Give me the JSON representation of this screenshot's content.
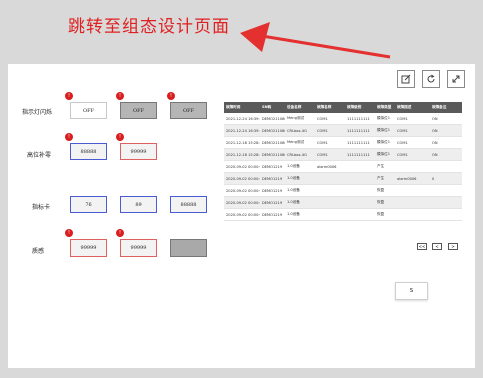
{
  "annotation": {
    "text": "跳转至组态设计页面",
    "color": "#e02020"
  },
  "toolbar": {
    "edit_icon": "edit-icon",
    "refresh_icon": "refresh-icon",
    "expand_icon": "expand-icon"
  },
  "rows": {
    "indicator": {
      "label": "指示灯闪烁",
      "boxes": [
        "OFF",
        "OFF",
        "OFF"
      ],
      "badges": [
        "!",
        "!",
        "!"
      ]
    },
    "high_zero": {
      "label": "高位补零",
      "boxes": [
        "88888",
        "99999"
      ],
      "badges": [
        "!",
        "!"
      ]
    },
    "indicator_card": {
      "label": "指标卡",
      "boxes": [
        "76",
        "89",
        "88888"
      ]
    },
    "gradient": {
      "label": "质感",
      "boxes": [
        "99999",
        "99999",
        ""
      ],
      "badges": [
        "!",
        "!"
      ]
    }
  },
  "table": {
    "headers": [
      "故障时间",
      "SN码",
      "设备名称",
      "故障名称",
      "故障级别",
      "故障类型",
      "故障描述",
      "故障备注"
    ],
    "rows": [
      [
        "2021-12-24 16:39:55",
        "DEMO211086",
        "Meng测试",
        "COM1",
        "1111111111",
        "模拟位1",
        "COM1",
        "ON"
      ],
      [
        "2021-12-24 16:39:55",
        "DEMO211086",
        "CRLbox-4G",
        "COM1",
        "1111111111",
        "模拟位1",
        "COM1",
        "ON"
      ],
      [
        "2021-12-18 15:28:54",
        "DEMO211086",
        "Meng测试",
        "COM1",
        "1111111111",
        "模拟位1",
        "COM1",
        "ON"
      ],
      [
        "2021-12-18 15:28:54",
        "DEMO211086",
        "CRLbox-4G",
        "COM1",
        "1111111111",
        "模拟位1",
        "COM1",
        "ON"
      ],
      [
        "2020-09-02 00:00:00",
        "DEMO1219",
        "1.0设备",
        "alarm0006",
        "",
        "产生",
        "",
        ""
      ],
      [
        "2020-09-02 00:00:00",
        "DEMO1219",
        "1.0设备",
        "",
        "",
        "产生",
        "alarm0006",
        "0"
      ],
      [
        "2020-09-02 00:00:00",
        "DEMO1219",
        "1.0设备",
        "",
        "",
        "恢复",
        "",
        ""
      ],
      [
        "2020-09-02 00:00:00",
        "DEMO1219",
        "1.0设备",
        "",
        "",
        "恢复",
        "",
        ""
      ],
      [
        "2020-09-02 00:00:00",
        "DEMO1219",
        "1.0设备",
        "",
        "",
        "恢复",
        "",
        ""
      ]
    ]
  },
  "pagination": {
    "first": "<<",
    "prev": "<",
    "next": ">"
  },
  "s_button": {
    "label": "S"
  }
}
